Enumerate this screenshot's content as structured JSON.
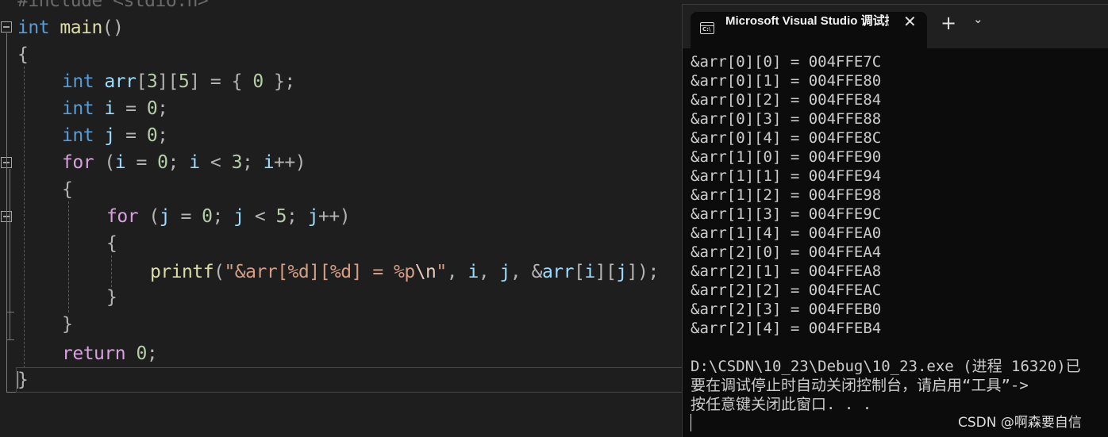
{
  "editor": {
    "line_0": "#include <stdio.h>",
    "line_1": {
      "type": "int",
      "name": "main",
      "parens": "()"
    },
    "line_2": "{",
    "line_3": {
      "type": "int",
      "name": "arr",
      "b1": "[",
      "d1": "3",
      "b2": "][",
      "d2": "5",
      "b3": "] = { ",
      "zero": "0",
      "end": " };"
    },
    "line_4": {
      "type": "int",
      "name": "i",
      "op": " = ",
      "val": "0",
      "end": ";"
    },
    "line_5": {
      "type": "int",
      "name": "j",
      "op": " = ",
      "val": "0",
      "end": ";"
    },
    "line_6": {
      "kw": "for",
      "p1": " (",
      "v1": "i",
      "eq": " = ",
      "n0": "0",
      "sc1": "; ",
      "v2": "i",
      "lt": " < ",
      "n3": "3",
      "sc2": "; ",
      "v3": "i",
      "inc": "++)"
    },
    "line_7": "{",
    "line_8": {
      "kw": "for",
      "p1": " (",
      "v1": "j",
      "eq": " = ",
      "n0": "0",
      "sc1": "; ",
      "v2": "j",
      "lt": " < ",
      "n5": "5",
      "sc2": "; ",
      "v3": "j",
      "inc": "++)"
    },
    "line_9": "{",
    "line_10": {
      "fn": "printf",
      "open": "(",
      "str1": "\"&arr[%d][%d] = %p",
      "esc": "\\n",
      "str2": "\"",
      "c1": ", ",
      "i": "i",
      "c2": ", ",
      "j": "j",
      "c3": ", ",
      "amp": "&",
      "arr": "arr",
      "b1": "[",
      "i2": "i",
      "b2": "][",
      "j2": "j",
      "close": "]);"
    },
    "line_11": "}",
    "line_12": "}",
    "line_13": {
      "kw": "return",
      "val": "0",
      "end": ";"
    },
    "line_14": "}"
  },
  "console": {
    "tab_title": "Microsoft Visual Studio 调试控制台",
    "tab_icon": "C:\\",
    "close_glyph": "✕",
    "new_tab_glyph": "+",
    "dropdown_glyph": "⌄",
    "output": [
      "&arr[0][0] = 004FFE7C",
      "&arr[0][1] = 004FFE80",
      "&arr[0][2] = 004FFE84",
      "&arr[0][3] = 004FFE88",
      "&arr[0][4] = 004FFE8C",
      "&arr[1][0] = 004FFE90",
      "&arr[1][1] = 004FFE94",
      "&arr[1][2] = 004FFE98",
      "&arr[1][3] = 004FFE9C",
      "&arr[1][4] = 004FFEA0",
      "&arr[2][0] = 004FFEA4",
      "&arr[2][1] = 004FFEA8",
      "&arr[2][2] = 004FFEAC",
      "&arr[2][3] = 004FFEB0",
      "&arr[2][4] = 004FFEB4"
    ],
    "exit_line": "D:\\CSDN\\10_23\\Debug\\10_23.exe (进程 16320)已",
    "hint_line": "要在调试停止时自动关闭控制台，请启用“工具”->",
    "press_key_line": "按任意键关闭此窗口. . ."
  },
  "watermark": "CSDN @啊森要自信"
}
